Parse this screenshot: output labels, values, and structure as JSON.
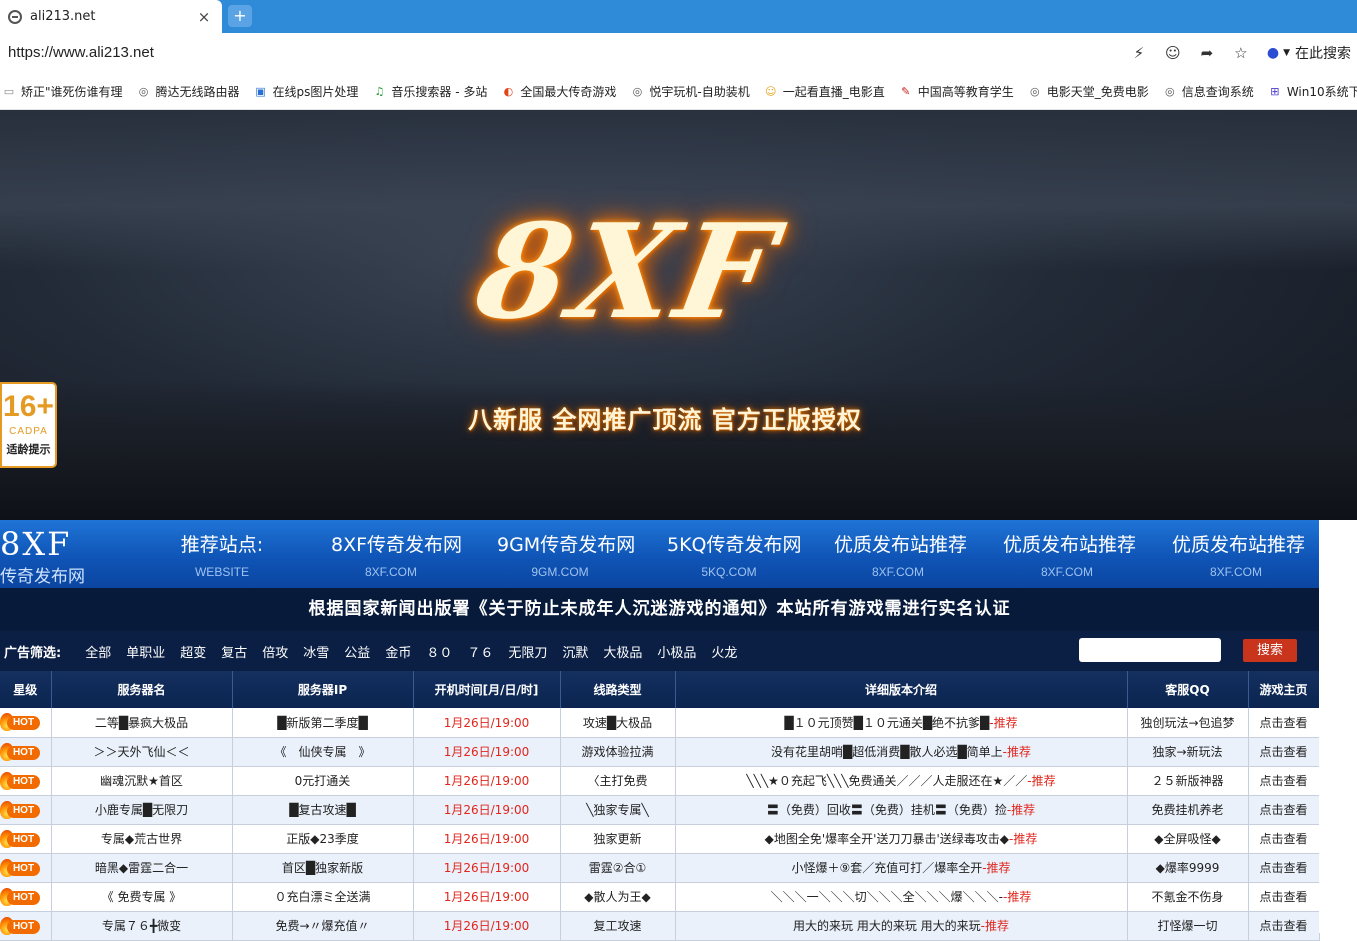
{
  "browser": {
    "tab_title": "ali213.net",
    "tab_close": "×",
    "new_tab": "+",
    "url": "https://www.ali213.net",
    "search_engine_label": "在此搜索",
    "bookmarks": [
      {
        "label": "矫正\"谁死伤谁有理",
        "icon": "bookmark-icon"
      },
      {
        "label": "腾达无线路由器",
        "icon": "globe-icon"
      },
      {
        "label": "在线ps图片处理",
        "icon": "image-icon"
      },
      {
        "label": "音乐搜索器 - 多站",
        "icon": "music-icon"
      },
      {
        "label": "全国最大传奇游戏",
        "icon": "game-icon"
      },
      {
        "label": "悦宇玩机-自助装机",
        "icon": "globe-icon"
      },
      {
        "label": "一起看直播_电影直",
        "icon": "smile-icon"
      },
      {
        "label": "中国高等教育学生",
        "icon": "edu-icon"
      },
      {
        "label": "电影天堂_免费电影",
        "icon": "globe-icon"
      },
      {
        "label": "信息查询系统",
        "icon": "globe-icon"
      },
      {
        "label": "Win10系统下",
        "icon": "windows-icon"
      }
    ]
  },
  "hero": {
    "logo": "8XF",
    "slogan": "八新服 全网推广顶流 官方正版授权",
    "rating_age": "16+",
    "rating_org": "CADPA",
    "rating_tip": "适龄提示"
  },
  "recommend": {
    "brand": "8XF",
    "brand_sub": "传奇发布网",
    "items": [
      {
        "name": "推荐站点:",
        "sub": "WEBSITE"
      },
      {
        "name": "8XF传奇发布网",
        "sub": "8XF.COM"
      },
      {
        "name": "9GM传奇发布网",
        "sub": "9GM.COM"
      },
      {
        "name": "5KQ传奇发布网",
        "sub": "5KQ.COM"
      },
      {
        "name": "优质发布站推荐",
        "sub": "8XF.COM"
      },
      {
        "name": "优质发布站推荐",
        "sub": "8XF.COM"
      },
      {
        "name": "优质发布站推荐",
        "sub": "8XF.COM"
      }
    ]
  },
  "notice": "根据国家新闻出版署《关于防止未成年人沉迷游戏的通知》本站所有游戏需进行实名认证",
  "filter": {
    "label": "广告筛选:",
    "items": [
      "全部",
      "单职业",
      "超变",
      "复古",
      "倍攻",
      "冰雪",
      "公益",
      "金币",
      "８０",
      "７６",
      "无限刀",
      "沉默",
      "大极品",
      "小极品",
      "火龙"
    ],
    "search_placeholder": "",
    "search_button": "搜索"
  },
  "table": {
    "headers": [
      "星级",
      "服务器名",
      "服务器IP",
      "开机时间[月/日/时]",
      "线路类型",
      "详细版本介绍",
      "客服QQ",
      "游戏主页"
    ],
    "hot_label": "HOT",
    "recommend_suffix": "-推荐",
    "rows": [
      {
        "name": "二等█暴疯大极品",
        "ip": "█新版第二季度█",
        "time": "1月26日/19:00",
        "line": "攻速█大极品",
        "intro": "█１０元顶赞█１０元通关█绝不抗爹█",
        "qq": "独创玩法→包追梦",
        "home": "点击查看"
      },
      {
        "name": "＞＞天外飞仙＜＜",
        "ip": "《　仙侠专属　》",
        "time": "1月26日/19:00",
        "line": "游戏体验拉满",
        "intro": "没有花里胡哨█超低消费█散人必选█简单上",
        "qq": "独家→新玩法",
        "home": "点击查看"
      },
      {
        "name": "幽魂沉默★首区",
        "ip": "0元打通关",
        "time": "1月26日/19:00",
        "line": "〈主打免费",
        "intro": "╲╲╲★０充起飞╲╲╲免费通关／／／人走服还在★／／",
        "qq": "２５新版神器",
        "home": "点击查看"
      },
      {
        "name": "小鹿专属█无限刀",
        "ip": "█复古攻速█",
        "time": "1月26日/19:00",
        "line": "╲独家专属╲",
        "intro": "〓（免费）回收〓（免费）挂机〓（免费）捡",
        "qq": "免费挂机养老",
        "home": "点击查看"
      },
      {
        "name": "专属◆荒古世界",
        "ip": "正版◆23季度",
        "time": "1月26日/19:00",
        "line": "独家更新",
        "intro": "◆地图全免'爆率全开'送刀刀暴击'送绿毒攻击◆",
        "qq": "◆全屏吸怪◆",
        "home": "点击查看"
      },
      {
        "name": "暗黑◆雷霆二合一",
        "ip": "首区█独家新版",
        "time": "1月26日/19:00",
        "line": "雷霆②合①",
        "intro": "小怪爆＋⑨套／充值可打／爆率全开",
        "qq": "◆爆率9999",
        "home": "点击查看"
      },
      {
        "name": "《 免费专属 》",
        "ip": "０充白漂ミ全送满",
        "time": "1月26日/19:00",
        "line": "◆散人为王◆",
        "intro": "＼＼＼一＼＼＼切＼＼＼全＼＼＼爆＼＼＼-",
        "qq": "不氪金不伤身",
        "home": "点击查看"
      },
      {
        "name": "专属７６╋微变",
        "ip": "免费→〃爆充值〃",
        "time": "1月26日/19:00",
        "line": "复工攻速",
        "intro": "用大的来玩 用大的来玩 用大的来玩",
        "qq": "打怪爆一切",
        "home": "点击查看"
      }
    ]
  }
}
